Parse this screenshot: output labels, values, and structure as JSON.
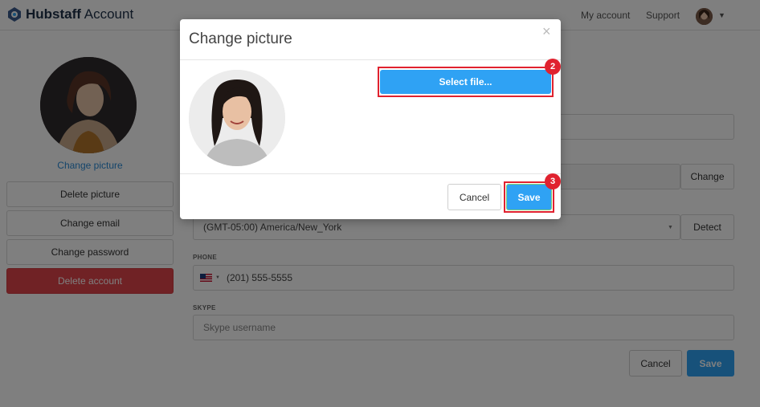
{
  "header": {
    "logo_brand": "Hubstaff",
    "logo_suffix": "Account",
    "nav": [
      "My account",
      "Support"
    ]
  },
  "sidebar": {
    "change_picture_link": "Change picture",
    "buttons": [
      "Delete picture",
      "Change email",
      "Change password",
      "Delete account"
    ]
  },
  "form": {
    "timezone_value": "(GMT-05:00) America/New_York",
    "change_button": "Change",
    "detect_button": "Detect",
    "phone_label": "PHONE",
    "phone_value": "(201) 555-5555",
    "skype_label": "SKYPE",
    "skype_placeholder": "Skype username",
    "cancel": "Cancel",
    "save": "Save"
  },
  "modal": {
    "title": "Change picture",
    "close_glyph": "×",
    "select_file": "Select file...",
    "cancel": "Cancel",
    "save": "Save",
    "step_select": "2",
    "step_save": "3"
  },
  "colors": {
    "accent": "#2fa2f4",
    "danger": "#e0454b",
    "annotation": "#e0222f",
    "link": "#2a8bd6"
  }
}
